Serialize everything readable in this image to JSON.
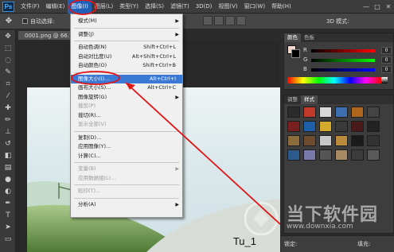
{
  "app": {
    "logo": "Ps",
    "menus": [
      "文件(F)",
      "编辑(E)",
      "图像(I)",
      "图层(L)",
      "类型(Y)",
      "选择(S)",
      "滤镜(T)",
      "3D(D)",
      "视图(V)",
      "窗口(W)",
      "帮助(H)"
    ],
    "active_menu": "图像(I)",
    "window_controls": [
      "—",
      "□",
      "✕"
    ]
  },
  "options_bar": {
    "auto_select_label": "自动选择:",
    "mode_3d_label": "3D 模式:"
  },
  "document": {
    "tab_title": "0001.png @ 66.7%",
    "caption": "Tu_1"
  },
  "image_menu": {
    "items": [
      {
        "label": "模式(M)",
        "shortcut": "",
        "submenu": true,
        "disabled": false,
        "selected": false
      },
      {
        "sep": true
      },
      {
        "label": "调整(J)",
        "shortcut": "",
        "submenu": true,
        "disabled": false,
        "selected": false
      },
      {
        "sep": true
      },
      {
        "label": "自动色调(N)",
        "shortcut": "Shift+Ctrl+L",
        "submenu": false,
        "disabled": false,
        "selected": false
      },
      {
        "label": "自动对比度(U)",
        "shortcut": "Alt+Shift+Ctrl+L",
        "submenu": false,
        "disabled": false,
        "selected": false
      },
      {
        "label": "自动颜色(O)",
        "shortcut": "Shift+Ctrl+B",
        "submenu": false,
        "disabled": false,
        "selected": false
      },
      {
        "sep": true
      },
      {
        "label": "图像大小(I)...",
        "shortcut": "Alt+Ctrl+I",
        "submenu": false,
        "disabled": false,
        "selected": true
      },
      {
        "label": "画布大小(S)...",
        "shortcut": "Alt+Ctrl+C",
        "submenu": false,
        "disabled": false,
        "selected": false
      },
      {
        "label": "图像旋转(G)",
        "shortcut": "",
        "submenu": true,
        "disabled": false,
        "selected": false
      },
      {
        "label": "裁剪(P)",
        "shortcut": "",
        "submenu": false,
        "disabled": true,
        "selected": false
      },
      {
        "label": "裁切(R)...",
        "shortcut": "",
        "submenu": false,
        "disabled": false,
        "selected": false
      },
      {
        "label": "显示全部(V)",
        "shortcut": "",
        "submenu": false,
        "disabled": true,
        "selected": false
      },
      {
        "sep": true
      },
      {
        "label": "复制(D)...",
        "shortcut": "",
        "submenu": false,
        "disabled": false,
        "selected": false
      },
      {
        "label": "应用图像(Y)...",
        "shortcut": "",
        "submenu": false,
        "disabled": false,
        "selected": false
      },
      {
        "label": "计算(C)...",
        "shortcut": "",
        "submenu": false,
        "disabled": false,
        "selected": false
      },
      {
        "sep": true
      },
      {
        "label": "变量(B)",
        "shortcut": "",
        "submenu": true,
        "disabled": true,
        "selected": false
      },
      {
        "label": "应用数据组(L)...",
        "shortcut": "",
        "submenu": false,
        "disabled": true,
        "selected": false
      },
      {
        "sep": true
      },
      {
        "label": "陷印(T)...",
        "shortcut": "",
        "submenu": false,
        "disabled": true,
        "selected": false
      },
      {
        "sep": true
      },
      {
        "label": "分析(A)",
        "shortcut": "",
        "submenu": true,
        "disabled": false,
        "selected": false
      }
    ]
  },
  "color_panel": {
    "tabs": [
      "颜色",
      "色板"
    ],
    "channels": [
      {
        "label": "R",
        "value": "0",
        "gradient": "linear-gradient(90deg,#000,#f00)"
      },
      {
        "label": "G",
        "value": "0",
        "gradient": "linear-gradient(90deg,#000,#0f0)"
      },
      {
        "label": "B",
        "value": "0",
        "gradient": "linear-gradient(90deg,#000,#00f)"
      }
    ]
  },
  "styles_panel": {
    "tabs": [
      "调整",
      "样式"
    ],
    "swatch_colors": [
      "#2b2b2b",
      "#c0392b",
      "#d9d9d9",
      "#3d6fb0",
      "#b0651d",
      "#444444",
      "#7a1f1f",
      "#1d5fa8",
      "#d4a92c",
      "#3a3a3a",
      "#4a1a1a",
      "#222222",
      "#8a6d3b",
      "#6d4c2f",
      "#c8c8c8",
      "#b98a3c",
      "#1a1a1a",
      "#333333",
      "#2c5a8a",
      "#7a7aaa",
      "#555555",
      "#a68a64",
      "#3b3b3b",
      "#5a5a5a"
    ]
  },
  "layers_bar": {
    "lock_label": "锁定:",
    "fill_label": "填充:"
  },
  "watermark": {
    "text": "当下软件园",
    "url": "www.downxia.com"
  },
  "colors": {
    "menubar_bg": "#3c3c3c",
    "menu_highlight": "#3a79d6",
    "annotation_red": "#e01515"
  }
}
